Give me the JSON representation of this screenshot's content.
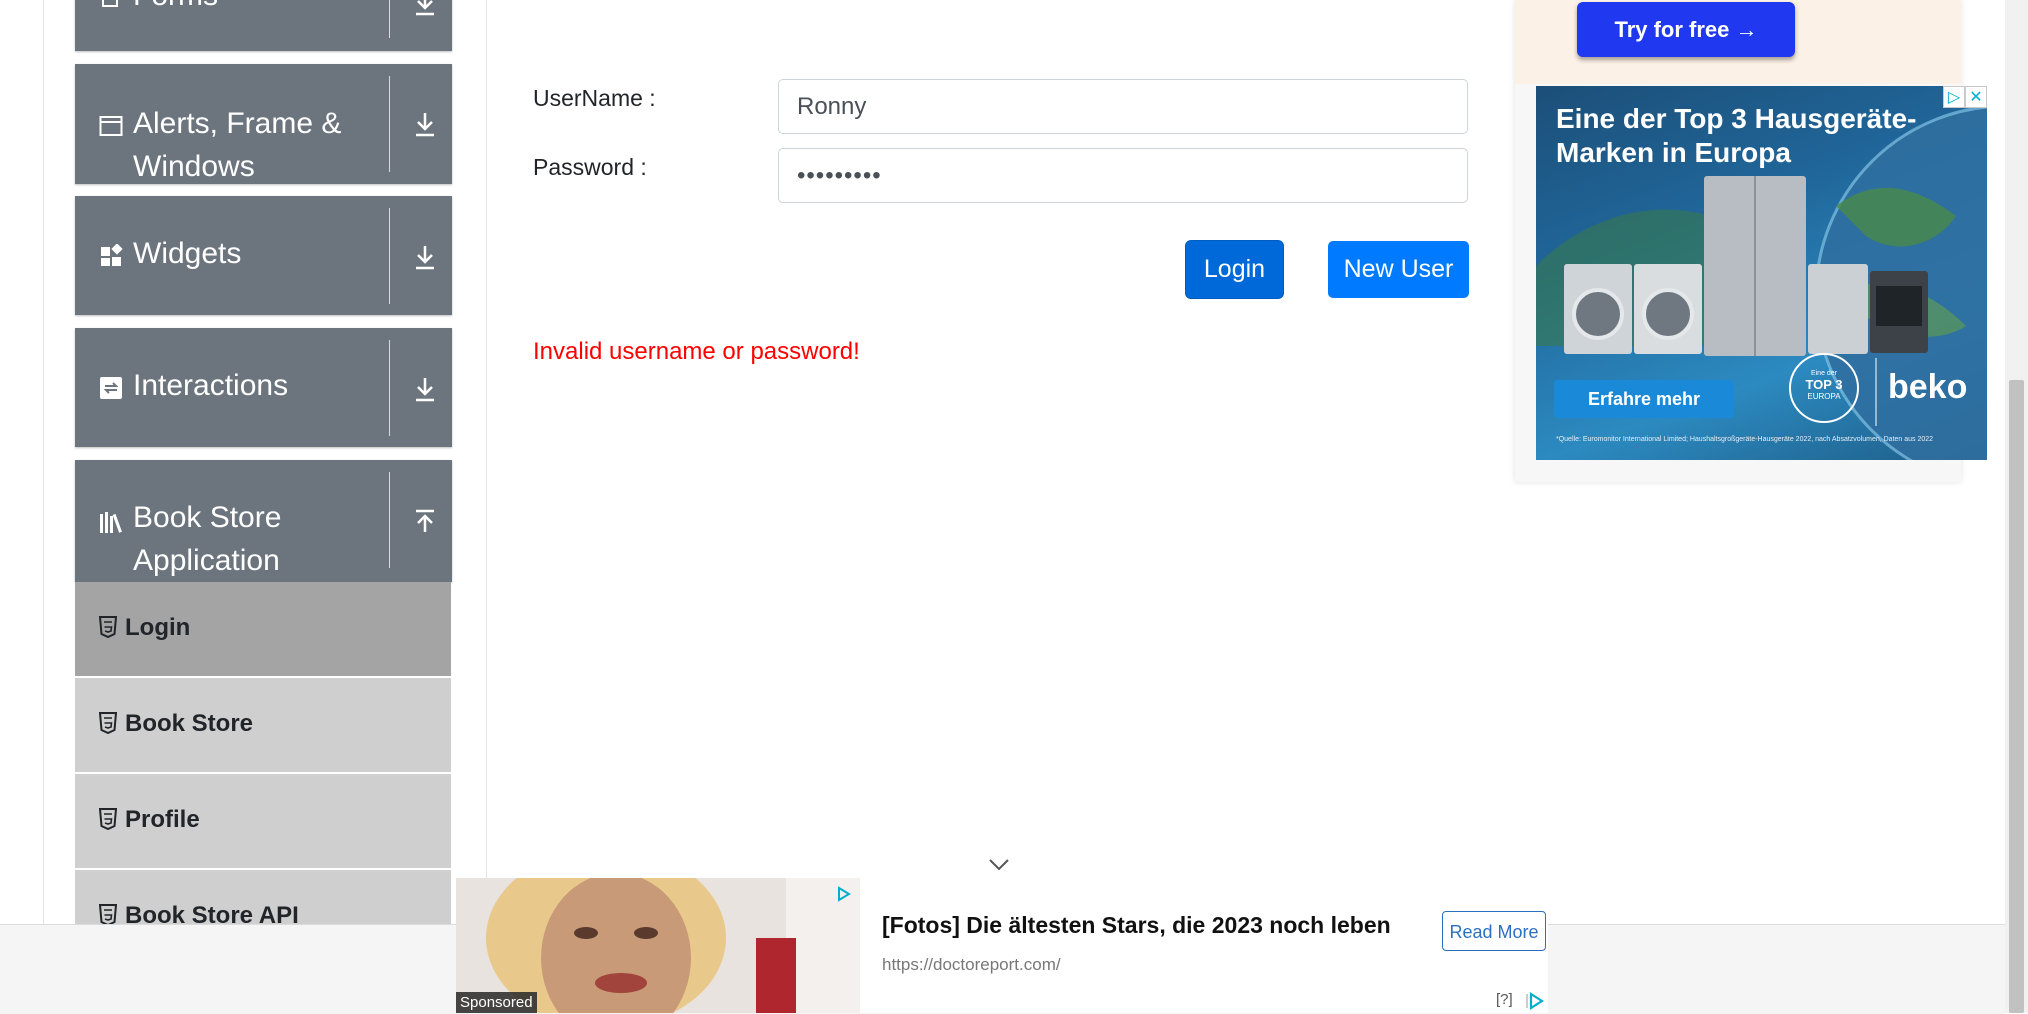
{
  "sidebar": {
    "groups": [
      {
        "label_line1": "Forms",
        "label_line2": "",
        "arrow": "down"
      },
      {
        "label_line1": "Alerts, Frame &",
        "label_line2": "Windows",
        "arrow": "down"
      },
      {
        "label_line1": "Widgets",
        "label_line2": "",
        "arrow": "down"
      },
      {
        "label_line1": "Interactions",
        "label_line2": "",
        "arrow": "down"
      },
      {
        "label_line1": "Book Store",
        "label_line2": "Application",
        "arrow": "up"
      }
    ],
    "items": [
      {
        "label": "Login",
        "active": true
      },
      {
        "label": "Book Store",
        "active": false
      },
      {
        "label": "Profile",
        "active": false
      },
      {
        "label": "Book Store API",
        "active": false
      }
    ]
  },
  "form": {
    "username_label": "UserName :",
    "username_value": "Ronny",
    "password_label": "Password :",
    "password_value": "•••••••••",
    "login_button": "Login",
    "new_user_button": "New User",
    "error_message": "Invalid username or password!"
  },
  "colors": {
    "sidebar_group": "#6c757d",
    "login_button": "#0069d9",
    "new_user_button": "#007bff",
    "error": "#ff0000"
  },
  "right_ad": {
    "try_button": "Try for free →",
    "headline": "Eine der Top 3 Hausgeräte-Marken in Europa",
    "cta": "Erfahre mehr",
    "brand": "beko",
    "badge_line1": "Eine der",
    "badge_line2": "TOP 3",
    "badge_line3": "EUROPA",
    "fine_print": "*Quelle: Euromonitor International Limited; Haushaltsgroßgeräte-Hausgeräte 2022, nach Absatzvolumen, Daten aus 2022"
  },
  "bottom_ad": {
    "sponsored_label": "Sponsored",
    "headline": "[Fotos] Die ältesten Stars, die 2023 noch leben",
    "url": "https://doctoreport.com/",
    "read_more": "Read More",
    "help": "[?]"
  }
}
